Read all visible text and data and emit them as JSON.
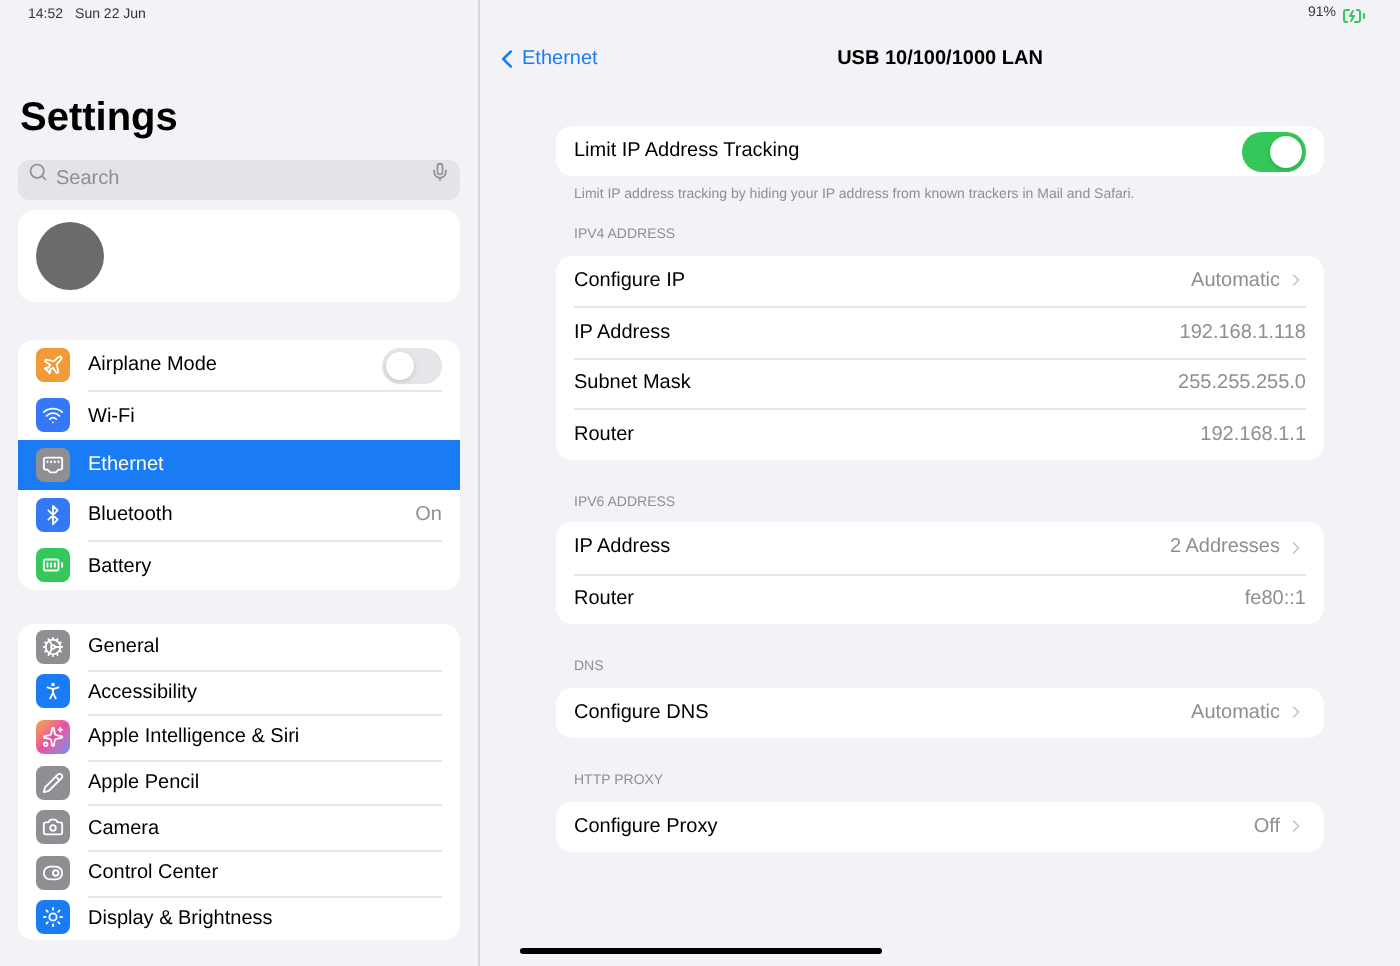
{
  "status_bar": {
    "time": "14:52",
    "date": "Sun 22 Jun",
    "battery": "91%"
  },
  "sidebar": {
    "title": "Settings",
    "search": {
      "placeholder": "Search"
    },
    "groups": [
      {
        "items": [
          {
            "label": "Airplane Mode",
            "kind": "toggle",
            "on": false,
            "selected": false
          },
          {
            "label": "Wi-Fi",
            "kind": "plain",
            "selected": false
          },
          {
            "label": "Ethernet",
            "kind": "plain",
            "selected": true
          },
          {
            "label": "Bluetooth",
            "kind": "value",
            "value": "On",
            "selected": false
          },
          {
            "label": "Battery",
            "kind": "plain",
            "selected": false
          }
        ]
      },
      {
        "items": [
          {
            "label": "General",
            "kind": "plain",
            "selected": false
          },
          {
            "label": "Accessibility",
            "kind": "plain",
            "selected": false
          },
          {
            "label": "Apple Intelligence & Siri",
            "kind": "plain",
            "selected": false
          },
          {
            "label": "Apple Pencil",
            "kind": "plain",
            "selected": false
          },
          {
            "label": "Camera",
            "kind": "plain",
            "selected": false
          },
          {
            "label": "Control Center",
            "kind": "plain",
            "selected": false
          },
          {
            "label": "Display & Brightness",
            "kind": "plain",
            "selected": false
          }
        ]
      }
    ]
  },
  "detail": {
    "back": "Ethernet",
    "title": "USB 10/100/1000 LAN",
    "tracking": {
      "label": "Limit IP Address Tracking",
      "on": true,
      "footer": "Limit IP address tracking by hiding your IP address from known trackers in Mail and Safari."
    },
    "sections": [
      {
        "header": "IPV4 ADDRESS",
        "rows": [
          {
            "label": "Configure IP",
            "value": "Automatic",
            "kind": "link"
          },
          {
            "label": "IP Address",
            "value": "192.168.1.118",
            "kind": "info"
          },
          {
            "label": "Subnet Mask",
            "value": "255.255.255.0",
            "kind": "info"
          },
          {
            "label": "Router",
            "value": "192.168.1.1",
            "kind": "info"
          }
        ]
      },
      {
        "header": "IPV6 ADDRESS",
        "rows": [
          {
            "label": "IP Address",
            "value": "2 Addresses",
            "kind": "link"
          },
          {
            "label": "Router",
            "value": "fe80::1",
            "kind": "info"
          }
        ]
      },
      {
        "header": "DNS",
        "rows": [
          {
            "label": "Configure DNS",
            "value": "Automatic",
            "kind": "link"
          }
        ]
      },
      {
        "header": "HTTP PROXY",
        "rows": [
          {
            "label": "Configure Proxy",
            "value": "Off",
            "kind": "link"
          }
        ]
      }
    ]
  }
}
